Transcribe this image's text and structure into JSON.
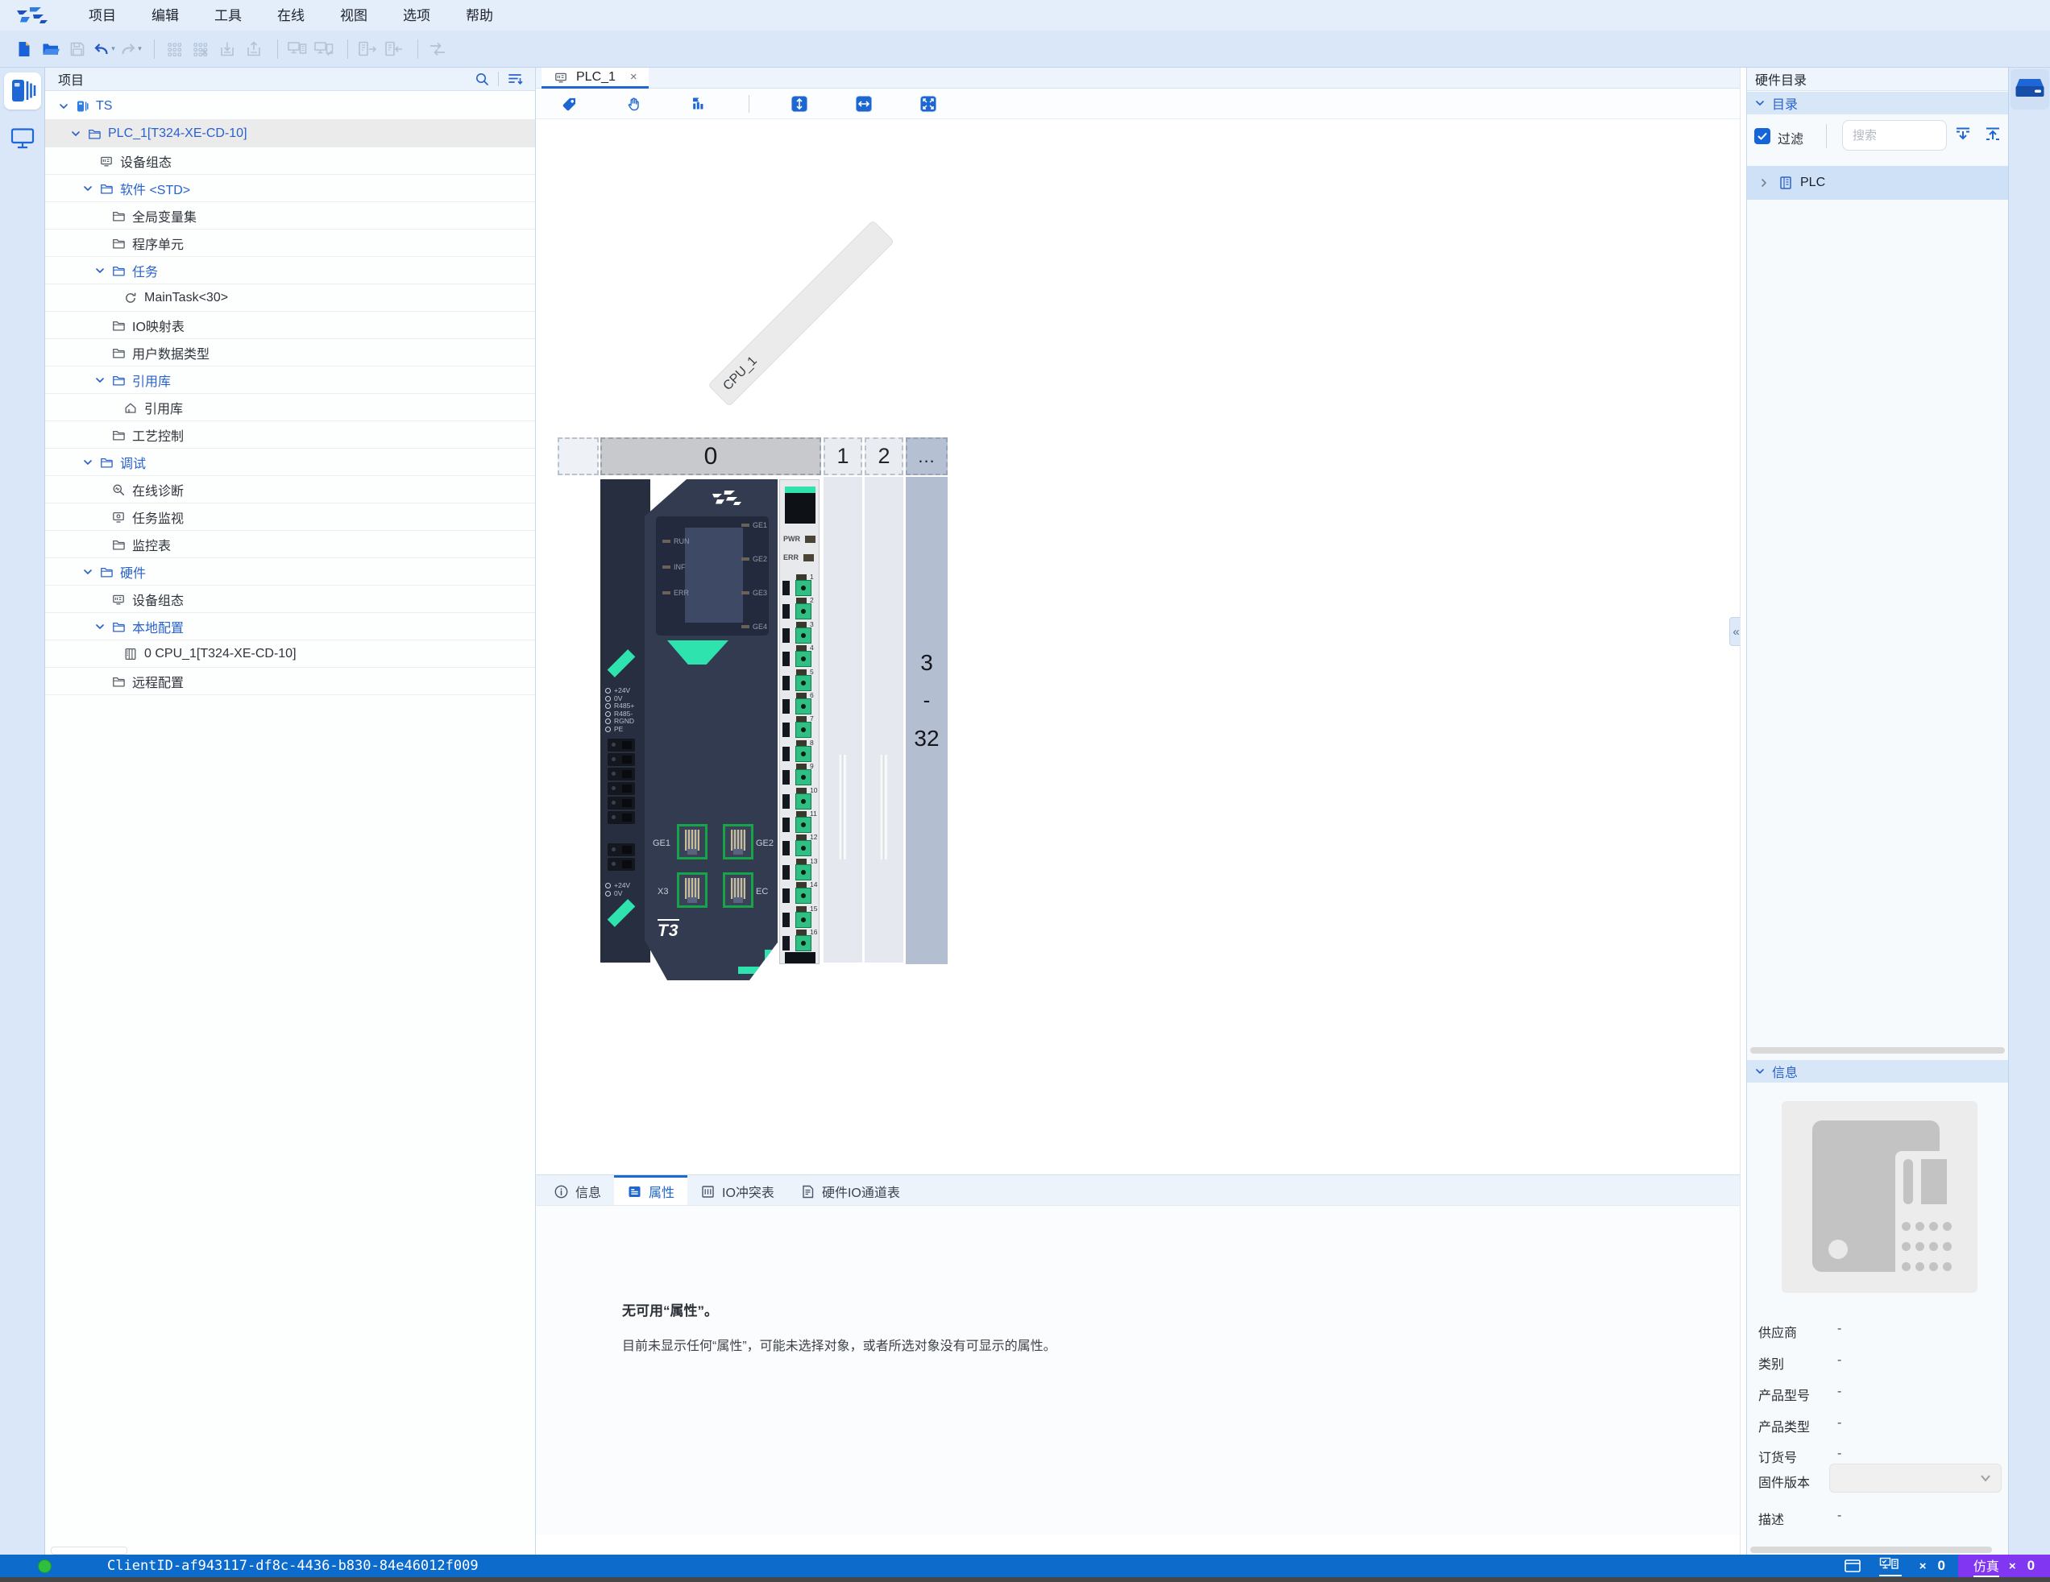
{
  "colors": {
    "accent": "#1e66d0",
    "statusbar_blue": "#0d6bcb",
    "sim_purple": "#8136f2",
    "device_teal": "#2fe3ae",
    "connector_green": "#2fbf83",
    "device_navy": "#333b50"
  },
  "menu_bar": {
    "items": [
      "项目",
      "编辑",
      "工具",
      "在线",
      "视图",
      "选项",
      "帮助"
    ]
  },
  "main_toolbar": {
    "buttons": [
      {
        "icon": "new-file",
        "enabled": true
      },
      {
        "icon": "open-folder",
        "enabled": true
      },
      {
        "icon": "save",
        "enabled": false
      },
      {
        "icon": "undo",
        "enabled": true,
        "caret": true
      },
      {
        "icon": "redo",
        "enabled": false,
        "caret": true
      },
      {
        "sep": true
      },
      {
        "icon": "grid-devices",
        "enabled": false
      },
      {
        "icon": "grid-devices-remove",
        "enabled": false
      },
      {
        "icon": "download-to-device",
        "enabled": false
      },
      {
        "icon": "upload-from-device",
        "enabled": false
      },
      {
        "sep": true
      },
      {
        "icon": "pc-connect",
        "enabled": false
      },
      {
        "icon": "pc-disconnect",
        "enabled": false
      },
      {
        "sep": true
      },
      {
        "icon": "device-export",
        "enabled": false
      },
      {
        "icon": "device-import",
        "enabled": false
      },
      {
        "sep": true
      },
      {
        "icon": "compare",
        "enabled": false
      }
    ]
  },
  "left_rail": {
    "items": [
      {
        "icon": "project-panel",
        "selected": true
      },
      {
        "icon": "monitor-panel",
        "selected": false
      }
    ]
  },
  "project_panel": {
    "title": "项目",
    "tree": [
      {
        "label": "TS",
        "level": 0,
        "icon": "ts-device",
        "expandable": true,
        "emph": true
      },
      {
        "label": "PLC_1[T324-XE-CD-10]",
        "level": 1,
        "icon": "folder",
        "expandable": true,
        "emph": true,
        "selected": true
      },
      {
        "label": "设备组态",
        "level": 2,
        "icon": "device-config"
      },
      {
        "label": "软件 <STD>",
        "level": 2,
        "icon": "folder",
        "expandable": true,
        "emph": true
      },
      {
        "label": "全局变量集",
        "level": 3,
        "icon": "folder"
      },
      {
        "label": "程序单元",
        "level": 3,
        "icon": "folder"
      },
      {
        "label": "任务",
        "level": 3,
        "icon": "folder",
        "expandable": true,
        "emph": true
      },
      {
        "label": "MainTask<30>",
        "level": 4,
        "icon": "refresh"
      },
      {
        "label": "IO映射表",
        "level": 3,
        "icon": "folder"
      },
      {
        "label": "用户数据类型",
        "level": 3,
        "icon": "folder"
      },
      {
        "label": "引用库",
        "level": 3,
        "icon": "folder",
        "expandable": true,
        "emph": true
      },
      {
        "label": "引用库",
        "level": 4,
        "icon": "library"
      },
      {
        "label": "工艺控制",
        "level": 3,
        "icon": "folder"
      },
      {
        "label": "调试",
        "level": 2,
        "icon": "folder",
        "expandable": true,
        "emph": true
      },
      {
        "label": "在线诊断",
        "level": 3,
        "icon": "diagnosis"
      },
      {
        "label": "任务监视",
        "level": 3,
        "icon": "task-monitor"
      },
      {
        "label": "监控表",
        "level": 3,
        "icon": "folder"
      },
      {
        "label": "硬件",
        "level": 2,
        "icon": "folder",
        "expandable": true,
        "emph": true
      },
      {
        "label": "设备组态",
        "level": 3,
        "icon": "device-config"
      },
      {
        "label": "本地配置",
        "level": 3,
        "icon": "folder",
        "expandable": true,
        "emph": true
      },
      {
        "label": "0 CPU_1[T324-XE-CD-10]",
        "level": 4,
        "icon": "cpu-module"
      },
      {
        "label": "远程配置",
        "level": 3,
        "icon": "folder"
      }
    ]
  },
  "editor": {
    "tab": {
      "label": "PLC_1"
    },
    "toolbar": {
      "buttons": [
        {
          "icon": "tag",
          "enabled": true
        },
        {
          "icon": "pan-hand",
          "enabled": true
        },
        {
          "icon": "chart-columns",
          "enabled": true
        },
        {
          "sep": true
        },
        {
          "icon": "fit-vertical",
          "enabled": true
        },
        {
          "icon": "fit-horizontal",
          "enabled": true
        },
        {
          "icon": "fit-all",
          "enabled": true
        }
      ]
    },
    "diagonal_label": "CPU_1",
    "collapse_handle": "«",
    "rack": {
      "slots": [
        {
          "label": "",
          "kind": "ghost"
        },
        {
          "label": "0",
          "kind": "occupied"
        },
        {
          "label": "1",
          "kind": "empty"
        },
        {
          "label": "2",
          "kind": "empty"
        },
        {
          "label": "...",
          "kind": "more"
        }
      ],
      "more_range": [
        "3",
        "-",
        "32"
      ]
    },
    "device": {
      "logo_text": "T3",
      "status_leds": [
        "RUN",
        "INF",
        "ERR"
      ],
      "port_leds": [
        "GE1",
        "GE2",
        "GE3",
        "GE4"
      ],
      "strip_leds": [
        "PWR",
        "ERR"
      ],
      "ports": [
        "GE1",
        "GE2",
        "X3",
        "EC"
      ],
      "terminals_top": [
        "+24V",
        "0V",
        "R485+",
        "R485-",
        "RGND",
        "PE"
      ],
      "terminals_bottom": [
        "+24V",
        "0V"
      ],
      "channels": [
        "1",
        "2",
        "3",
        "4",
        "5",
        "6",
        "7",
        "8",
        "9",
        "10",
        "11",
        "12",
        "13",
        "14",
        "15",
        "16"
      ]
    }
  },
  "bottom_panel": {
    "tabs": [
      {
        "label": "信息",
        "icon": "info"
      },
      {
        "label": "属性",
        "icon": "properties",
        "active": true
      },
      {
        "label": "IO冲突表",
        "icon": "io-conflict"
      },
      {
        "label": "硬件IO通道表",
        "icon": "io-channel-table"
      }
    ],
    "empty_title": "无可用“属性”。",
    "empty_body": "目前未显示任何“属性”，可能未选择对象，或者所选对象没有可显示的属性。"
  },
  "catalog_panel": {
    "title": "硬件目录",
    "catalog_section": "目录",
    "filter_label": "过滤",
    "filter_checked": true,
    "search_placeholder": "搜索",
    "items": [
      {
        "label": "PLC",
        "icon": "plc-module"
      }
    ],
    "info_section": "信息",
    "info_fields": [
      {
        "label": "供应商",
        "value": "-"
      },
      {
        "label": "类别",
        "value": "-"
      },
      {
        "label": "产品型号",
        "value": "-"
      },
      {
        "label": "产品类型",
        "value": "-"
      },
      {
        "label": "订货号",
        "value": "-"
      },
      {
        "label": "固件版本",
        "value": "",
        "type": "select"
      },
      {
        "label": "描述",
        "value": "-"
      }
    ]
  },
  "status_bar": {
    "client_id": "ClientID-af943117-df8c-4436-b830-84e46012f009",
    "times": "×",
    "error_count": "0",
    "sim_label": "仿真",
    "sim_count": "0"
  }
}
